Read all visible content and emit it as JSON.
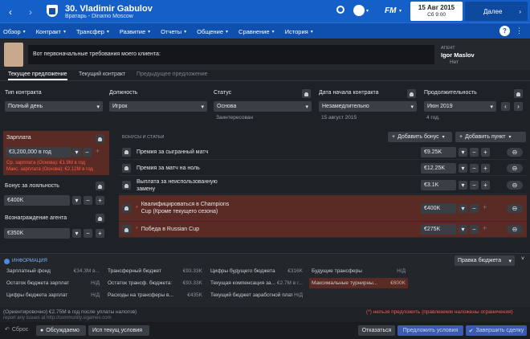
{
  "header": {
    "player_title": "30. Vladimir Gabulov",
    "player_subtitle": "Вратарь - Dinamo Moscow",
    "date": "15 Авг 2015",
    "day_time": "Сб 9:00",
    "continue_label": "Далее",
    "fm_logo": "FM"
  },
  "nav": [
    "Обзор",
    "Контракт",
    "Трансфер",
    "Развитие",
    "Отчеты",
    "Общение",
    "Сравнение",
    "История"
  ],
  "agent": {
    "label": "АГЕНТ",
    "name": "Igor Maslov",
    "status": "Нет"
  },
  "message": "Вот первоначальные требования моего клиента:",
  "tabs": [
    "Текущее предложение",
    "Текущий контракт",
    "Предыдущее предложение"
  ],
  "contract": {
    "type_label": "Тип контракта",
    "type_value": "Полный день",
    "role_label": "Должность",
    "role_value": "Игрок",
    "status_label": "Статус",
    "status_value": "Основа",
    "status_note": "Заинтересован",
    "start_label": "Дата начала контракта",
    "start_value": "Незамедлительно",
    "start_note": "15 август 2015",
    "duration_label": "Продолжительность",
    "duration_value": "Июн 2019",
    "duration_note": "4 год."
  },
  "salary": {
    "label": "Зарплата",
    "value": "€3,200,000 в год",
    "avg": "Ср. зарплата (Основа): €1.9M в год",
    "max": "Макс. зарплата (Основа): €2.12M в год"
  },
  "loyalty": {
    "label": "Бонус за лояльность",
    "value": "€400K"
  },
  "agent_fee": {
    "label": "Вознаграждение агента",
    "value": "€350K"
  },
  "bonuses": {
    "section_label": "БОНУСЫ И СТАТЬИ",
    "add_bonus": "Добавить бонус",
    "add_clause": "Добавить пункт",
    "items": [
      {
        "label": "Премия за сыгранный матч",
        "value": "€9.25K"
      },
      {
        "label": "Премия за матч на ноль",
        "value": "€12.25K"
      },
      {
        "label": "Выплата за неиспользованную замену",
        "value": "€3.1K"
      },
      {
        "label": "Квалифицироваться в Champions Cup (Кроме текущего сезона)",
        "value": "€400K"
      },
      {
        "label": "Победа в Russian Cup",
        "value": "€275K"
      }
    ]
  },
  "info": {
    "title": "ИНФОРМАЦИЯ",
    "budget_select": "Правка бюджета",
    "cells": [
      {
        "k": "Зарплатный фонд",
        "v": "€34.3M в..."
      },
      {
        "k": "Трансферный бюджет",
        "v": "€93.33K"
      },
      {
        "k": "Цифры будущего бюджета",
        "v": "€316K"
      },
      {
        "k": "Будущие трансферы",
        "v": "Н/Д"
      },
      {
        "k": "Остаток бюджета зарплат",
        "v": "Н/Д"
      },
      {
        "k": "Остаток трансф. бюджета:",
        "v": "€93.33K"
      },
      {
        "k": "Текущая компенсация за...",
        "v": "€2.7M в г..."
      },
      {
        "k": "Максимальные турнирны...",
        "v": "€600K"
      },
      {
        "k": "Цифры бюджета зарплат",
        "v": "Н/Д"
      },
      {
        "k": "Расходы на трансферы в...",
        "v": "€435K"
      },
      {
        "k": "Текущий бюджет заработной плат...",
        "v": "Н/Д"
      }
    ]
  },
  "footer": {
    "net": "(Ориентировочно) €2.75M в год после уплаты налогов)",
    "note": "(*) нельзя предложить (правлением наложены ограничения)",
    "report": "report any issues at http://community.sigames.com",
    "reset": "Сброс",
    "discussed": "Обсуждаемо",
    "use_current": "Исп текущ условия",
    "decline": "Отказаться",
    "propose": "Предложить условия",
    "finish": "Завершить сделку"
  },
  "colors": {
    "accent": "#1560c8",
    "warning_row": "#5a2b24",
    "negative": "#ff5a4a"
  }
}
